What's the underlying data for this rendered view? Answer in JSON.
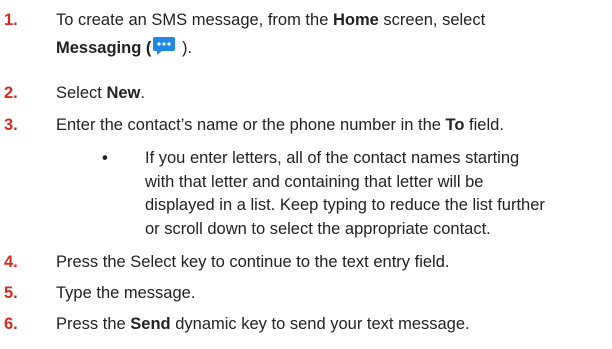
{
  "colors": {
    "number": "#d62b22",
    "text": "#222222",
    "icon": "#1e88e5"
  },
  "steps": [
    {
      "num": "1.",
      "line1_pre": "To create an SMS message, from the ",
      "line1_bold": "Home",
      "line1_post": " screen, select",
      "line2_bold": "Messaging (",
      "icon": "messaging-icon",
      "line2_post": " )."
    },
    {
      "num": "2.",
      "pre": "Select ",
      "bold": "New",
      "post": "."
    },
    {
      "num": "3.",
      "pre": "Enter the contact’s name or the phone number in the ",
      "bold": "To",
      "post": " field."
    },
    {
      "num": "4.",
      "text": "Press the Select key to continue to the text entry field."
    },
    {
      "num": "5.",
      "text": "Type the message."
    },
    {
      "num": "6.",
      "pre": "Press the ",
      "bold": "Send",
      "post": " dynamic key to send your text message."
    }
  ],
  "sub_bullet": {
    "bullet": "•",
    "lines": [
      "If you enter letters, all of the contact names starting",
      "with that letter and containing that letter will be",
      "displayed in a list. Keep typing to reduce the list further",
      "or scroll down to select the appropriate contact."
    ]
  }
}
